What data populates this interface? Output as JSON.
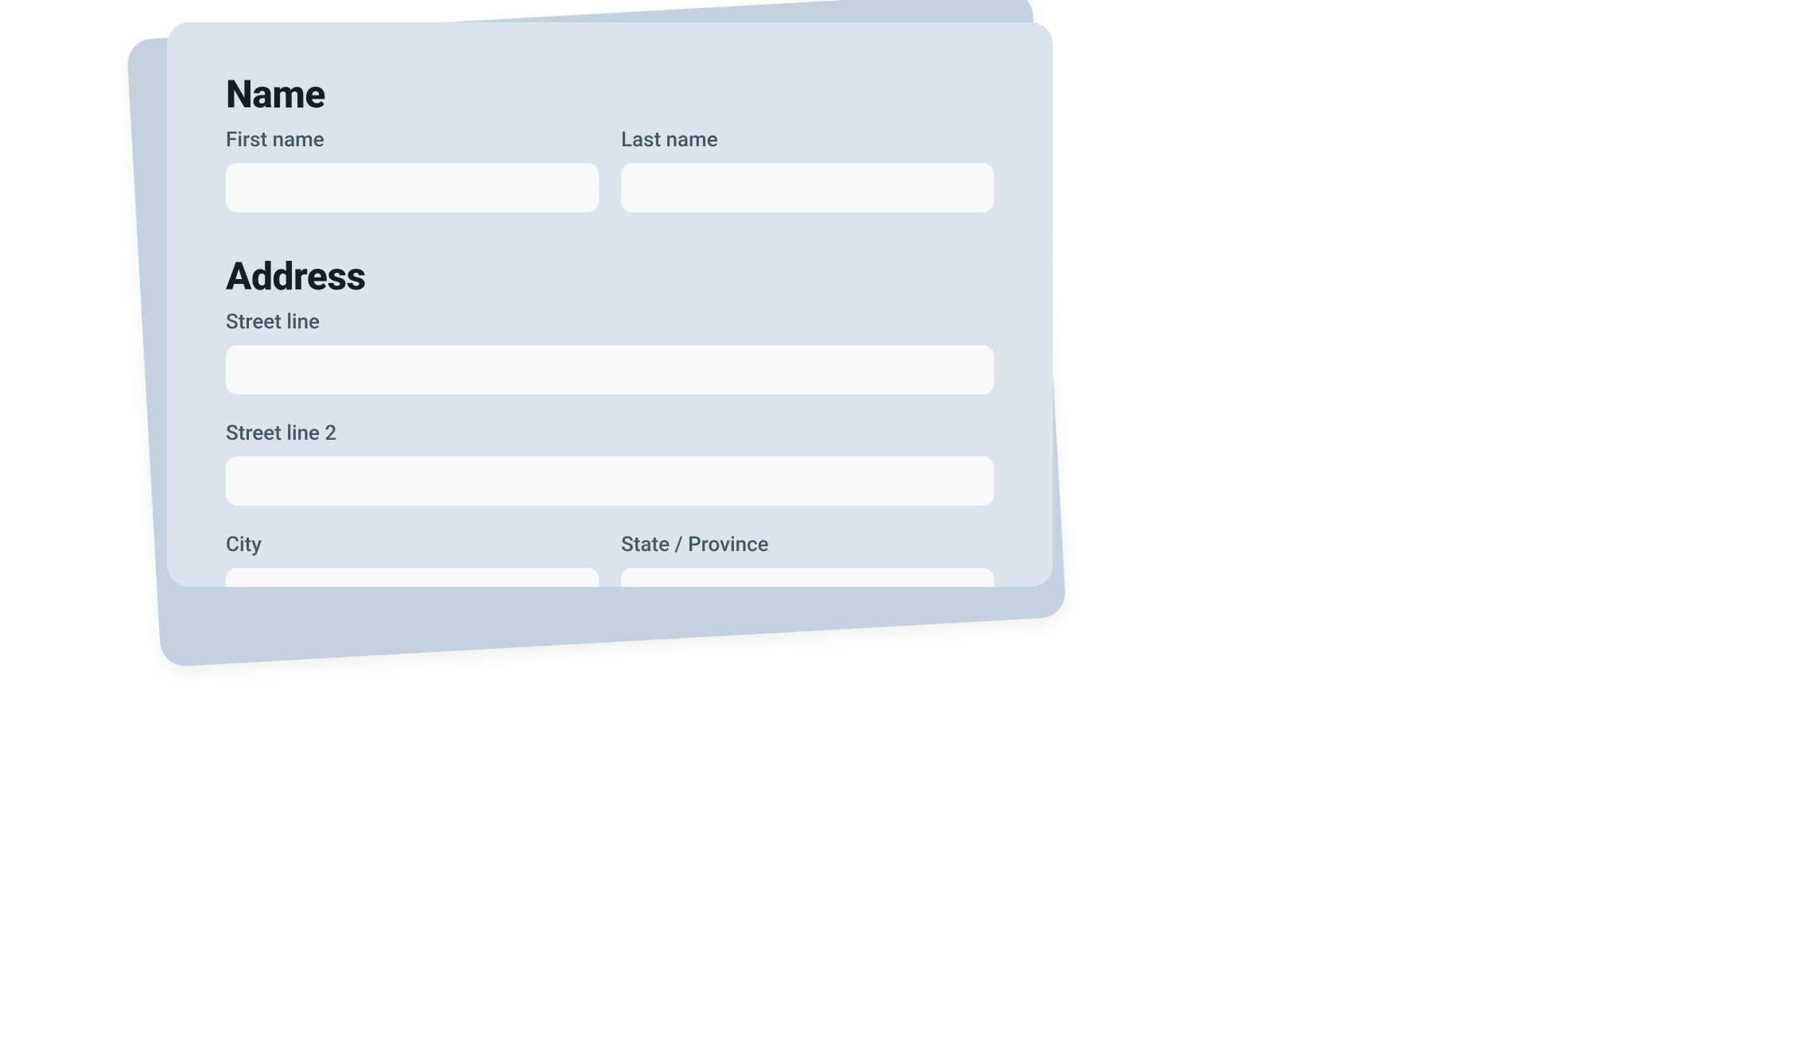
{
  "nameSection": {
    "title": "Name",
    "firstNameLabel": "First name",
    "firstNameValue": "",
    "lastNameLabel": "Last name",
    "lastNameValue": ""
  },
  "addressSection": {
    "title": "Address",
    "street1Label": "Street line",
    "street1Value": "",
    "street2Label": "Street line 2",
    "street2Value": "",
    "cityLabel": "City",
    "cityValue": "",
    "stateLabel": "State / Province",
    "stateValue": ""
  }
}
